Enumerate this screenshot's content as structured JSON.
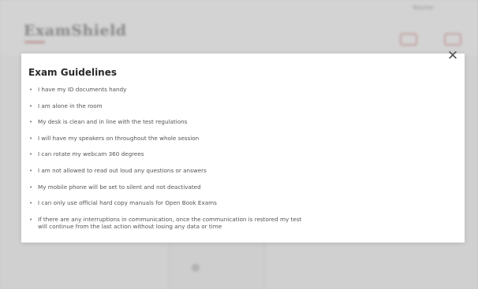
{
  "background": {
    "logo_text": "ExamShield",
    "user_text": "Teacher"
  },
  "modal": {
    "title": "Exam Guidelines",
    "close_glyph": "✕",
    "bullet_glyph": "•",
    "guidelines": [
      "I have my ID documents handy",
      "I am alone in the room",
      "My desk is clean and in line with the test regulations",
      "I will have my speakers on throughout the whole session",
      "I can rotate my webcam 360 degrees",
      "I am not allowed to read out loud any questions or answers",
      "My mobile phone will be set to silent and not deactivated",
      "I can only use official hard copy manuals for Open Book Exams",
      "If there are any interruptions in communication, once the communication is restored my test\nwill continue from the last action without losing any data or time"
    ]
  }
}
